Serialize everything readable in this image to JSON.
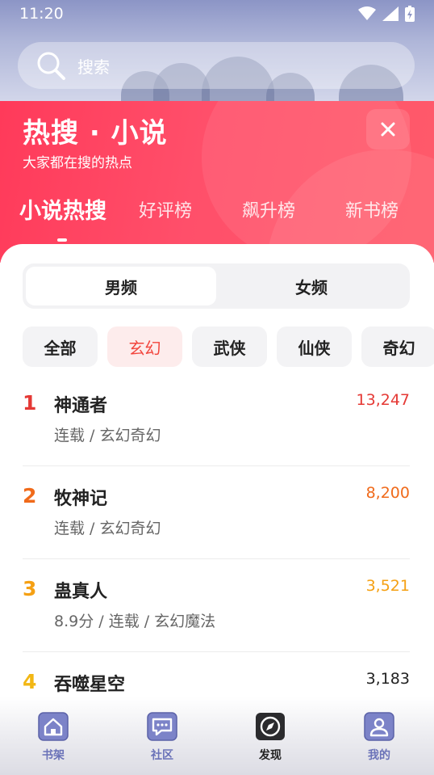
{
  "status_bar": {
    "time": "11:20"
  },
  "search": {
    "placeholder": "搜索"
  },
  "hot_panel": {
    "title": "热搜 · 小说",
    "subtitle": "大家都在搜的热点",
    "tabs": [
      {
        "label": "小说热搜",
        "active": true
      },
      {
        "label": "好评榜",
        "active": false
      },
      {
        "label": "飙升榜",
        "active": false
      },
      {
        "label": "新书榜",
        "active": false
      }
    ]
  },
  "gender_toggle": [
    {
      "label": "男频",
      "active": true
    },
    {
      "label": "女频",
      "active": false
    }
  ],
  "genre_chips": [
    {
      "label": "全部",
      "active": false
    },
    {
      "label": "玄幻",
      "active": true
    },
    {
      "label": "武侠",
      "active": false
    },
    {
      "label": "仙侠",
      "active": false
    },
    {
      "label": "奇幻",
      "active": false
    }
  ],
  "ranking": [
    {
      "rank": "1",
      "title": "神通者",
      "meta": "连载 / 玄幻奇幻",
      "score": "13,247",
      "color": "#e53935"
    },
    {
      "rank": "2",
      "title": "牧神记",
      "meta": "连载 / 玄幻奇幻",
      "score": "8,200",
      "color": "#f06a1a"
    },
    {
      "rank": "3",
      "title": "蛊真人",
      "meta": "8.9分 / 连载 / 玄幻魔法",
      "score": "3,521",
      "color": "#f5a013"
    },
    {
      "rank": "4",
      "title": "吞噬星空",
      "meta": "",
      "score": "3,183",
      "color": "#f2b714",
      "score_color": "#222222"
    }
  ],
  "bottom_nav": [
    {
      "label": "书架",
      "icon": "bookshelf-house-icon",
      "active": false
    },
    {
      "label": "社区",
      "icon": "community-chat-icon",
      "active": false
    },
    {
      "label": "发现",
      "icon": "discover-compass-icon",
      "active": true
    },
    {
      "label": "我的",
      "icon": "profile-person-icon",
      "active": false
    }
  ],
  "colors": {
    "accent": "#ff3a5a",
    "active_chip": "#f2453d",
    "nav_inactive": "#6a72b8",
    "nav_active": "#222222"
  }
}
